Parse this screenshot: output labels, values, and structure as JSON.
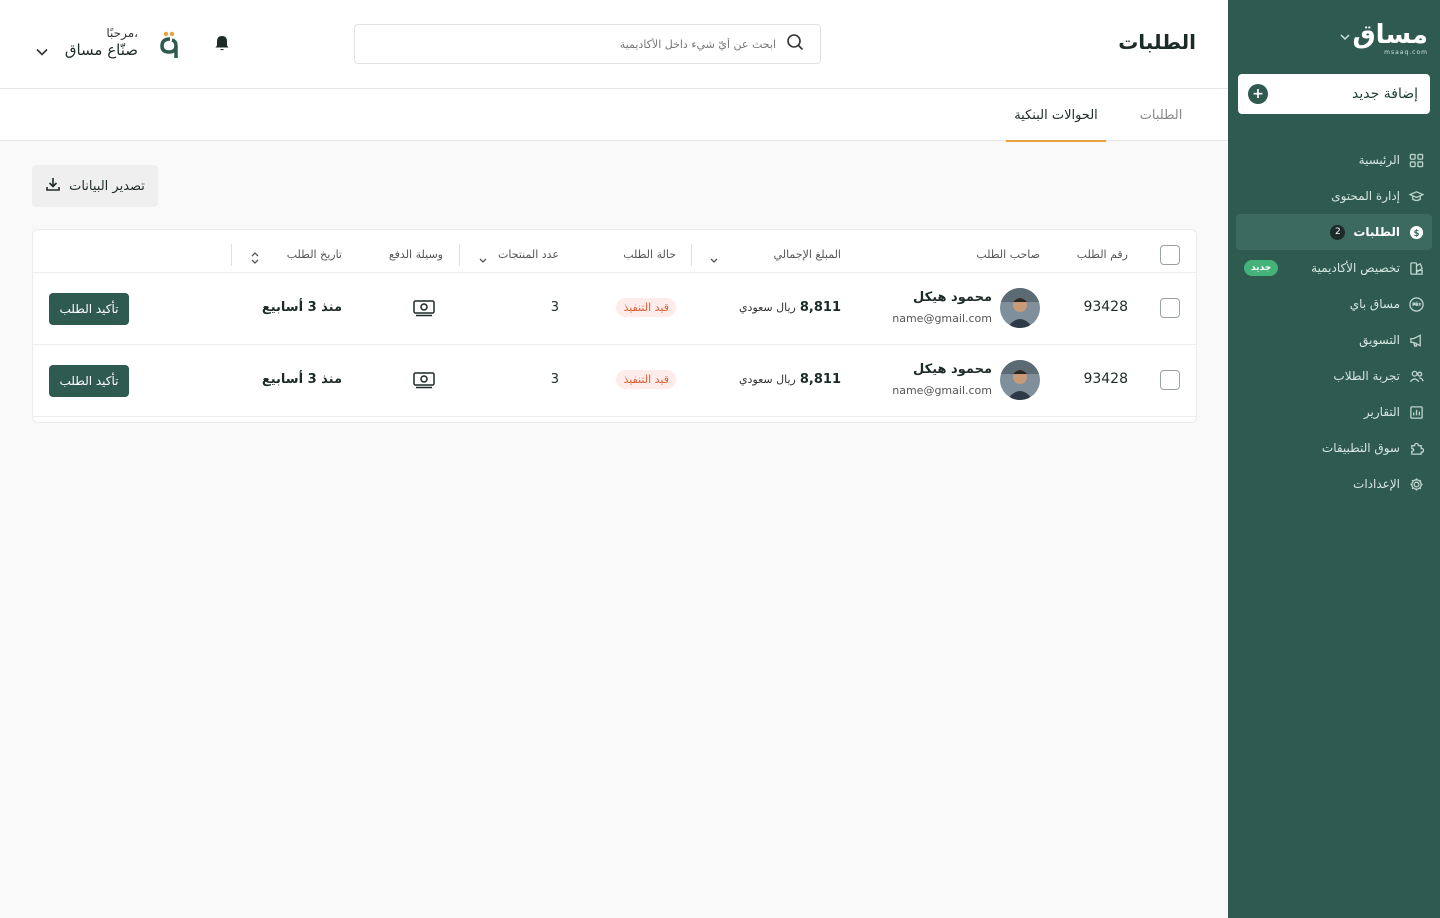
{
  "sidebar": {
    "brand_name": "مساق",
    "brand_domain": "msaaq.com",
    "add_new_label": "إضافة جديد",
    "items": [
      {
        "label": "الرئيسية",
        "icon": "grid-icon"
      },
      {
        "label": "إدارة المحتوى",
        "icon": "graduation-cap-icon"
      },
      {
        "label": "الطلبات",
        "icon": "dollar-circle-icon",
        "count": "2",
        "active": true
      },
      {
        "label": "تخصيص الأكاديمية",
        "icon": "palette-icon",
        "badge": "جديد"
      },
      {
        "label": "مساق باي",
        "icon": "pay-icon"
      },
      {
        "label": "التسويق",
        "icon": "megaphone-icon"
      },
      {
        "label": "تجربة الطلاب",
        "icon": "users-icon"
      },
      {
        "label": "التقارير",
        "icon": "chart-icon"
      },
      {
        "label": "سوق التطبيقات",
        "icon": "puzzle-icon"
      },
      {
        "label": "الإعدادات",
        "icon": "gear-icon"
      }
    ]
  },
  "header": {
    "title": "الطلبات",
    "search_placeholder": "ابحث عن أيّ شيء داخل الأكاديمية",
    "greeting": "مرحبًا،",
    "user_name": "صنّاع مساق"
  },
  "tabs": [
    {
      "label": "الطلبات",
      "active": false
    },
    {
      "label": "الحوالات البنكية",
      "active": true
    }
  ],
  "export_label": "تصدير البيانات",
  "table": {
    "columns": {
      "order_no": "رقم الطلب",
      "customer": "صاحب الطلب",
      "amount": "المبلغ الإجمالي",
      "status": "حالة الطلب",
      "products": "عدد المنتجات",
      "payment": "وسيلة الدفع",
      "date": "تاريخ الطلب"
    },
    "rows": [
      {
        "order_no": "93428",
        "name": "محمود هيكل",
        "email": "name@gmail.com",
        "amount": "8,811",
        "currency": "ريال سعودي",
        "status": "قيد التنفيذ",
        "products": "3",
        "payment_icon": "cash-icon",
        "date": "منذ 3 أسابيع",
        "action": "تأكيد الطلب"
      },
      {
        "order_no": "93428",
        "name": "محمود هيكل",
        "email": "name@gmail.com",
        "amount": "8,811",
        "currency": "ريال سعودي",
        "status": "قيد التنفيذ",
        "products": "3",
        "payment_icon": "cash-icon",
        "date": "منذ 3 أسابيع",
        "action": "تأكيد الطلب"
      }
    ]
  },
  "colors": {
    "sidebar_bg": "#2f5a4f",
    "accent_tab": "#e8a33c",
    "status_text": "#e0623a",
    "status_bg": "#fdecea",
    "badge_green": "#45b279"
  }
}
